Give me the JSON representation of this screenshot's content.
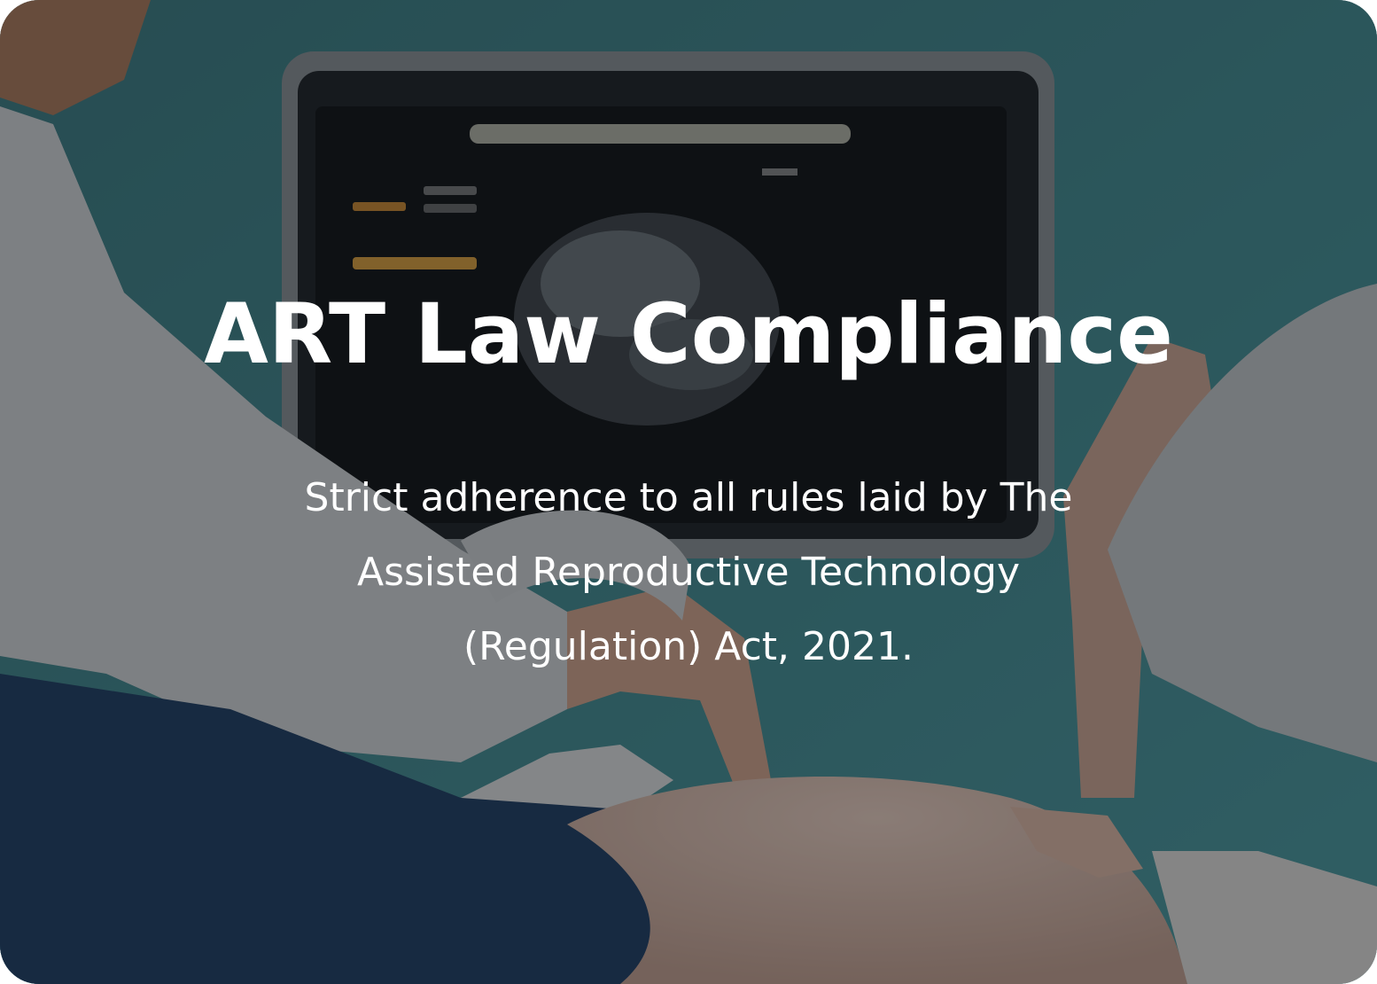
{
  "card": {
    "title": "ART Law Compliance",
    "description": "Strict adherence to all rules laid by The Assisted Reproductive Technology (Regulation) Act, 2021."
  },
  "colors": {
    "wall": "#3f8a90",
    "overlay": "#12161a",
    "text": "#ffffff",
    "monitor_frame": "#8a8f92",
    "lab_coat": "#d9dcdd",
    "jeans": "#1d3c63",
    "skin": "#e0b8a3"
  }
}
